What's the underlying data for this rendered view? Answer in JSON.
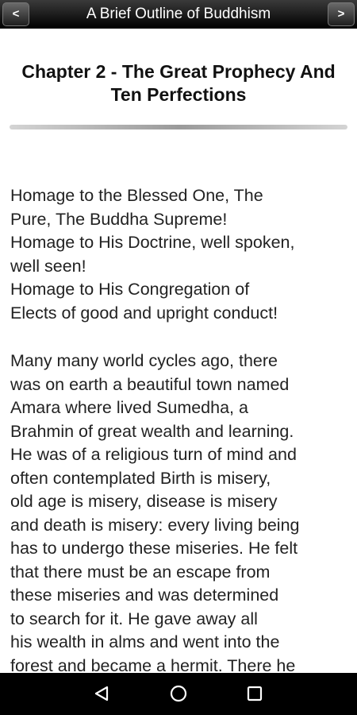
{
  "toolbar": {
    "title": "A Brief Outline of Buddhism",
    "prev_label": "<",
    "next_label": ">"
  },
  "chapter": {
    "title_line1": "Chapter 2 - The Great Prophecy And",
    "title_line2": "Ten Perfections"
  },
  "paragraphs": [
    {
      "lines": [
        "Homage to the Blessed One, The",
        "Pure, The Buddha Supreme!",
        "Homage to His Doctrine, well spoken,",
        "well seen!",
        "Homage to His Congregation of",
        "Elects of good and upright conduct!"
      ]
    },
    {
      "lines": [
        "Many many world cycles ago, there",
        "was on earth a beautiful town named",
        "Amara where lived Sumedha, a",
        "Brahmin of great wealth and learning.",
        "He was of a religious turn of mind and",
        "often contemplated Birth is misery,",
        "old age is misery, disease is misery",
        "and death is misery: every living being",
        "has to undergo these miseries. He felt",
        "that there must be an escape from",
        "these miseries and was determined",
        "to search for it. He gave away all",
        "his wealth in alms and went into the",
        "forest and became a hermit. There he"
      ]
    }
  ],
  "navbar": {
    "back_icon": "triangle-back-icon",
    "home_icon": "circle-home-icon",
    "recents_icon": "square-recents-icon"
  }
}
